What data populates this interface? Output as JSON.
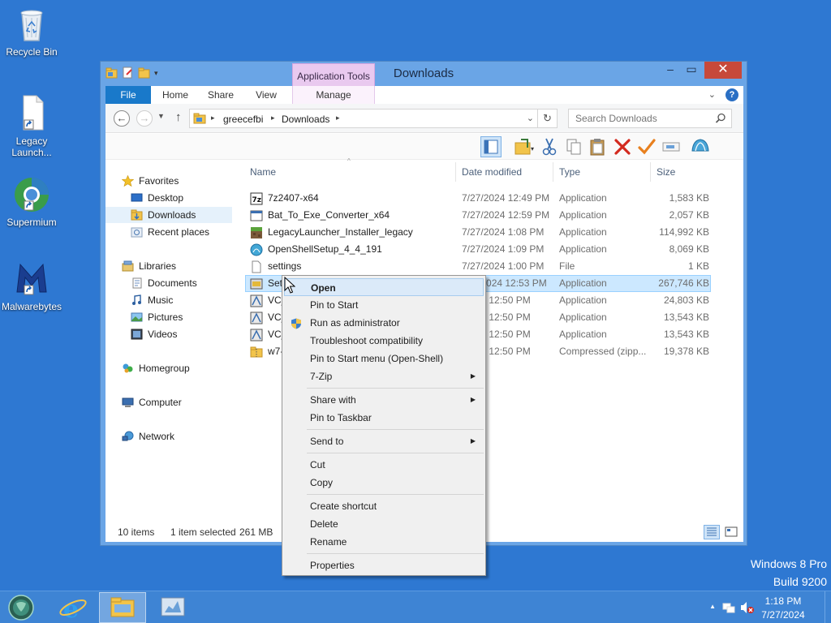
{
  "desktop": {
    "icons": [
      {
        "label": "Recycle Bin",
        "icon": "recycle-bin-icon"
      },
      {
        "label": "Legacy Launch...",
        "icon": "shortcut-file-icon"
      },
      {
        "label": "Supermium",
        "icon": "supermium-icon"
      },
      {
        "label": "Malwarebytes",
        "icon": "malwarebytes-icon"
      }
    ],
    "watermark": {
      "line1": "Windows 8 Pro",
      "line2": "Build 9200"
    }
  },
  "window": {
    "title": "Downloads",
    "contextual_tab_group": "Application Tools",
    "ribbon_tabs": {
      "file": "File",
      "home": "Home",
      "share": "Share",
      "view": "View",
      "manage": "Manage"
    },
    "help": "?",
    "close": "✕",
    "address": {
      "segments": [
        "greecefbi",
        "Downloads"
      ]
    },
    "search": {
      "placeholder": "Search Downloads"
    },
    "nav": {
      "favorites": "Favorites",
      "desktop": "Desktop",
      "downloads": "Downloads",
      "recent": "Recent places",
      "libraries": "Libraries",
      "documents": "Documents",
      "music": "Music",
      "pictures": "Pictures",
      "videos": "Videos",
      "homegroup": "Homegroup",
      "computer": "Computer",
      "network": "Network"
    },
    "columns": {
      "name": "Name",
      "date": "Date modified",
      "type": "Type",
      "size": "Size"
    },
    "files": [
      {
        "name": "7z2407-x64",
        "date": "7/27/2024 12:49 PM",
        "type": "Application",
        "size": "1,583 KB",
        "icon": "7zip-installer-icon"
      },
      {
        "name": "Bat_To_Exe_Converter_x64",
        "date": "7/27/2024 12:59 PM",
        "type": "Application",
        "size": "2,057 KB",
        "icon": "application-icon"
      },
      {
        "name": "LegacyLauncher_Installer_legacy",
        "date": "7/27/2024 1:08 PM",
        "type": "Application",
        "size": "114,992 KB",
        "icon": "minecraft-block-icon"
      },
      {
        "name": "OpenShellSetup_4_4_191",
        "date": "7/27/2024 1:09 PM",
        "type": "Application",
        "size": "8,069 KB",
        "icon": "openshell-icon"
      },
      {
        "name": "settings",
        "date": "7/27/2024 1:00 PM",
        "type": "File",
        "size": "1 KB",
        "icon": "blank-file-icon"
      },
      {
        "name": "Setu",
        "date": "7/2  /2024 12:53 PM",
        "type": "Application",
        "size": "267,746 KB",
        "icon": "setup-icon"
      },
      {
        "name": "VC_",
        "date": "/2024 12:50 PM",
        "type": "Application",
        "size": "24,803 KB",
        "icon": "vc-redist-icon"
      },
      {
        "name": "VC_",
        "date": "/2024 12:50 PM",
        "type": "Application",
        "size": "13,543 KB",
        "icon": "vc-redist-icon"
      },
      {
        "name": "VC_",
        "date": "/2024 12:50 PM",
        "type": "Application",
        "size": "13,543 KB",
        "icon": "vc-redist-icon"
      },
      {
        "name": "w7-",
        "date": "/2024 12:50 PM",
        "type": "Compressed (zipp...",
        "size": "19,378 KB",
        "icon": "zip-folder-icon"
      }
    ],
    "status": {
      "count": "10 items",
      "selected": "1 item selected",
      "size": "261 MB"
    }
  },
  "context_menu": {
    "open": "Open",
    "pin_start": "Pin to Start",
    "run_admin": "Run as administrator",
    "troubleshoot": "Troubleshoot compatibility",
    "pin_openshell": "Pin to Start menu (Open-Shell)",
    "sevenzip": "7-Zip",
    "share_with": "Share with",
    "pin_taskbar": "Pin to Taskbar",
    "send_to": "Send to",
    "cut": "Cut",
    "copy": "Copy",
    "create_shortcut": "Create shortcut",
    "delete": "Delete",
    "rename": "Rename",
    "properties": "Properties"
  },
  "taskbar": {
    "time": "1:18 PM",
    "date": "7/27/2024"
  },
  "colors": {
    "desktop": "#2e78d2",
    "window_frame": "#6aa5e6",
    "file_tab": "#1979ca",
    "app_tools": "#e9c9ef",
    "close": "#c7493a",
    "selection": "#cce8ff",
    "taskbar": "#3e84d4"
  }
}
